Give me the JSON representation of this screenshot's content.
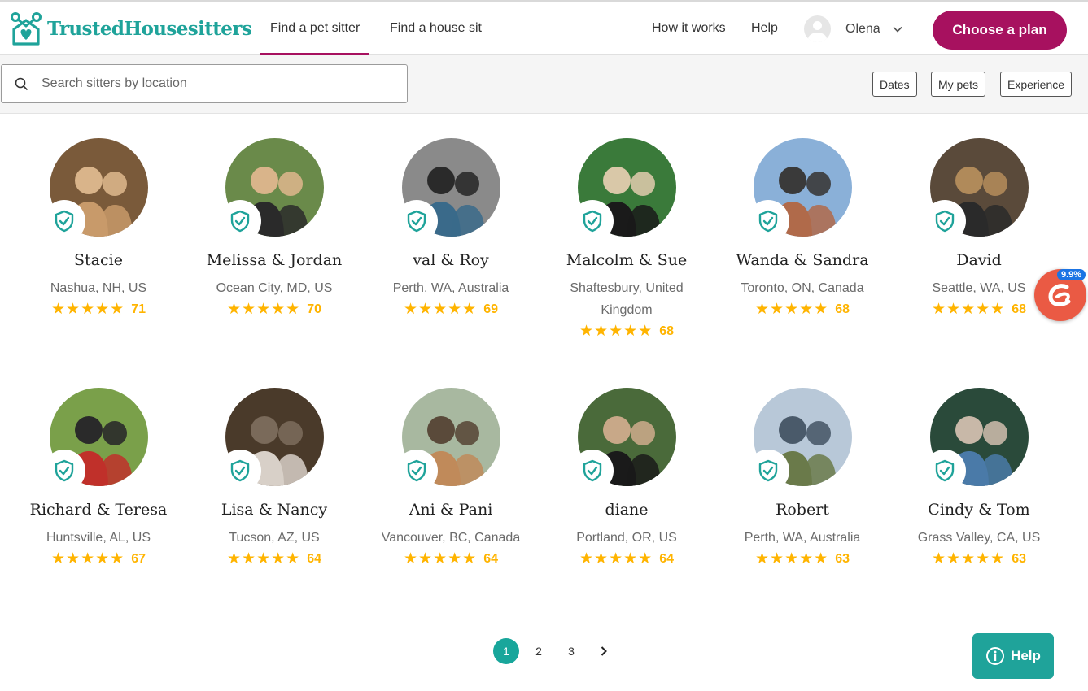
{
  "header": {
    "brand": "TrustedHousesitters",
    "nav": {
      "find_sitter": "Find a pet sitter",
      "find_house": "Find a house sit",
      "how_it_works": "How it works",
      "help": "Help"
    },
    "user_name": "Olena",
    "plan_button": "Choose a plan"
  },
  "search": {
    "placeholder": "Search sitters by location",
    "filters": {
      "dates": "Dates",
      "pets": "My pets",
      "experience": "Experience"
    }
  },
  "sitters": [
    {
      "name": "Stacie",
      "location": "Nashua, NH, US",
      "reviews": "71",
      "stars": 5,
      "photo_colors": [
        "#7a5a3a",
        "#c89a6a",
        "#d9b48a"
      ]
    },
    {
      "name": "Melissa & Jordan",
      "location": "Ocean City, MD, US",
      "reviews": "70",
      "stars": 5,
      "photo_colors": [
        "#6a8a4a",
        "#2a2a2a",
        "#d9b48a"
      ]
    },
    {
      "name": "val & Roy",
      "location": "Perth, WA, Australia",
      "reviews": "69",
      "stars": 5,
      "photo_colors": [
        "#8a8a8a",
        "#3a6a8a",
        "#2a2a2a"
      ]
    },
    {
      "name": "Malcolm & Sue",
      "location": "Shaftesbury, United Kingdom",
      "reviews": "68",
      "stars": 5,
      "photo_colors": [
        "#3a7a3a",
        "#1a1a1a",
        "#d9c8a8"
      ]
    },
    {
      "name": "Wanda & Sandra",
      "location": "Toronto, ON, Canada",
      "reviews": "68",
      "stars": 5,
      "photo_colors": [
        "#8ab0d8",
        "#b06a4a",
        "#3a3a3a"
      ]
    },
    {
      "name": "David",
      "location": "Seattle, WA, US",
      "reviews": "68",
      "stars": 5,
      "photo_colors": [
        "#5a4a3a",
        "#2a2a2a",
        "#b08a5a"
      ]
    },
    {
      "name": "Richard & Teresa",
      "location": "Huntsville, AL, US",
      "reviews": "67",
      "stars": 5,
      "photo_colors": [
        "#7aa04a",
        "#c0302a",
        "#2a2a2a"
      ]
    },
    {
      "name": "Lisa & Nancy",
      "location": "Tucson, AZ, US",
      "reviews": "64",
      "stars": 5,
      "photo_colors": [
        "#4a3a2a",
        "#d8d0c8",
        "#7a6a5a"
      ]
    },
    {
      "name": "Ani & Pani",
      "location": "Vancouver, BC, Canada",
      "reviews": "64",
      "stars": 5,
      "photo_colors": [
        "#a8b8a0",
        "#c08a5a",
        "#5a4a3a"
      ]
    },
    {
      "name": "diane",
      "location": "Portland, OR, US",
      "reviews": "64",
      "stars": 5,
      "photo_colors": [
        "#4a6a3a",
        "#1a1a1a",
        "#c8a888"
      ]
    },
    {
      "name": "Robert",
      "location": "Perth, WA, Australia",
      "reviews": "63",
      "stars": 5,
      "photo_colors": [
        "#b8c8d8",
        "#6a7a4a",
        "#4a5a6a"
      ]
    },
    {
      "name": "Cindy & Tom",
      "location": "Grass Valley, CA, US",
      "reviews": "63",
      "stars": 5,
      "photo_colors": [
        "#2a4a3a",
        "#4a7aa8",
        "#c8b8a8"
      ]
    }
  ],
  "pagination": {
    "pages": [
      "1",
      "2",
      "3"
    ],
    "current": "1"
  },
  "help_widget": "Help",
  "extension_badge": "9.9%",
  "colors": {
    "brand_teal": "#1fa39a",
    "plan_button": "#a7115f",
    "star": "#ffb400"
  },
  "icons": [
    "logo-icon",
    "search-icon",
    "chevron-down-icon",
    "verified-shield-icon",
    "star-icon",
    "chevron-right-icon",
    "info-icon"
  ]
}
